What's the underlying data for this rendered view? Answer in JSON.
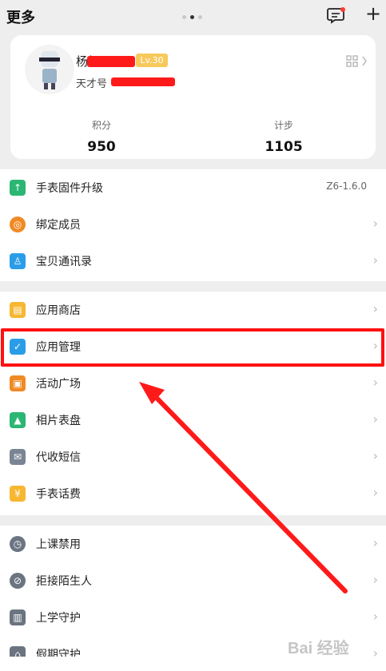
{
  "header": {
    "title": "更多"
  },
  "profile": {
    "name": "杨帆",
    "level": "Lv.30",
    "subline": "天才号",
    "stats": [
      {
        "label": "积分",
        "value": "950"
      },
      {
        "label": "计步",
        "value": "1105"
      }
    ]
  },
  "sections": [
    {
      "items": [
        {
          "label": "手表固件升级",
          "value": "Z6-1.6.0",
          "icon": "upgrade-icon",
          "color": "#2bb673"
        },
        {
          "label": "绑定成员",
          "value": "",
          "icon": "bind-members-icon",
          "color": "#f08a24"
        },
        {
          "label": "宝贝通讯录",
          "value": "",
          "icon": "contacts-icon",
          "color": "#2b9de8"
        }
      ]
    },
    {
      "items": [
        {
          "label": "应用商店",
          "value": "",
          "icon": "app-store-icon",
          "color": "#f7b733"
        },
        {
          "label": "应用管理",
          "value": "",
          "icon": "app-manage-icon",
          "color": "#2b9de8"
        },
        {
          "label": "活动广场",
          "value": "",
          "icon": "gift-icon",
          "color": "#f08a24"
        },
        {
          "label": "相片表盘",
          "value": "",
          "icon": "photo-icon",
          "color": "#2bb673"
        },
        {
          "label": "代收短信",
          "value": "",
          "icon": "mail-icon",
          "color": "#7a8594"
        },
        {
          "label": "手表话费",
          "value": "",
          "icon": "yuan-icon",
          "color": "#f7b733"
        }
      ]
    },
    {
      "items": [
        {
          "label": "上课禁用",
          "value": "",
          "icon": "class-disable-icon",
          "color": "#6b7480"
        },
        {
          "label": "拒接陌生人",
          "value": "",
          "icon": "reject-stranger-icon",
          "color": "#6b7480"
        },
        {
          "label": "上学守护",
          "value": "",
          "icon": "school-guard-icon",
          "color": "#6b7480"
        },
        {
          "label": "假期守护",
          "value": "",
          "icon": "holiday-guard-icon",
          "color": "#6b7480"
        }
      ]
    }
  ],
  "watermark": "Bai 经验"
}
